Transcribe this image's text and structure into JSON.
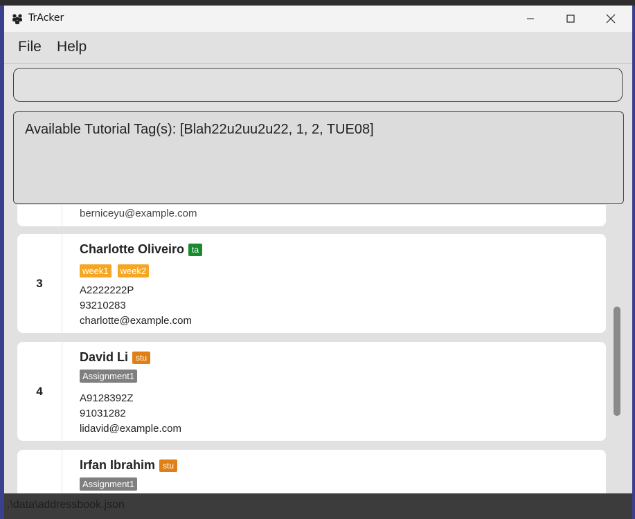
{
  "window": {
    "title": "TrAcker"
  },
  "menu": {
    "file": "File",
    "help": "Help"
  },
  "command_box": {
    "value": ""
  },
  "result_box": {
    "text": "Available Tutorial Tag(s): [Blah22u2uu2u22, 1, 2, TUE08]"
  },
  "persons": [
    {
      "email_partial": "berniceyu@example.com"
    },
    {
      "index": "3",
      "name": "Charlotte Oliveiro",
      "role": "ta",
      "tags": [
        "week1",
        "week2"
      ],
      "id": "A2222222P",
      "phone": "93210283",
      "email": "charlotte@example.com"
    },
    {
      "index": "4",
      "name": "David Li",
      "role": "stu",
      "tags": [
        "Assignment1"
      ],
      "id": "A9128392Z",
      "phone": "91031282",
      "email": "lidavid@example.com"
    },
    {
      "name": "Irfan Ibrahim",
      "role": "stu",
      "tags": [
        "Assignment1"
      ]
    }
  ],
  "status": {
    "path": ".\\data\\addressbook.json"
  },
  "colors": {
    "ta": "#1a8a2e",
    "stu": "#e07f16",
    "week_tag": "#f5a623",
    "assignment_tag": "#7f7f7f"
  }
}
